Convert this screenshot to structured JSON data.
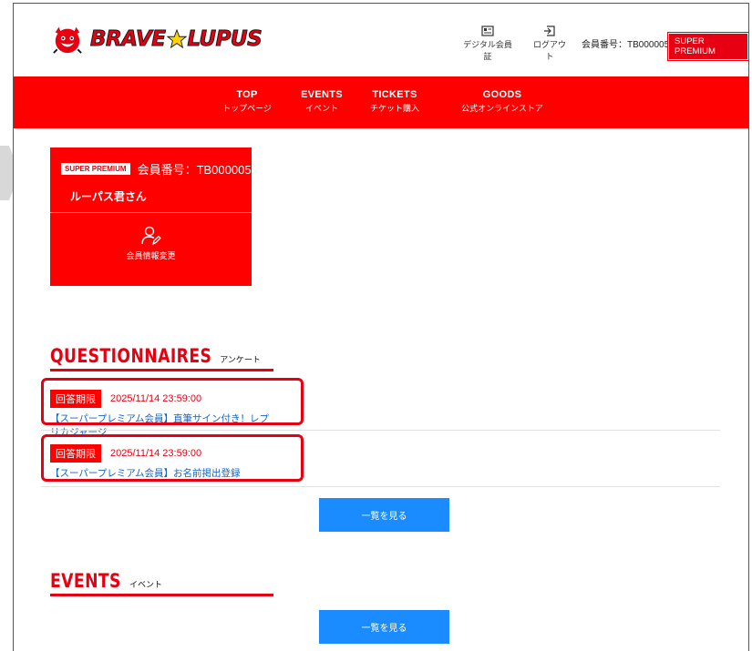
{
  "header": {
    "brand": {
      "word1": "BRAVE",
      "word2": "LUPUS"
    },
    "digital_card_label": "デジタル会員証",
    "logout_label": "ログアウト",
    "member_no": "会員番号：TB000005",
    "rank_badge": "SUPER PREMIUM"
  },
  "nav": [
    {
      "en": "TOP",
      "jp": "トップページ"
    },
    {
      "en": "EVENTS",
      "jp": "イベント"
    },
    {
      "en": "TICKETS",
      "jp": "チケット購入"
    },
    {
      "en": "GOODS",
      "jp": "公式オンラインストア"
    }
  ],
  "member_card": {
    "rank_badge": "SUPER PREMIUM",
    "member_no": "会員番号：TB000005",
    "name": "ルーパス君さん",
    "edit_label": "会員情報変更"
  },
  "questionnaires": {
    "title": "QUESTIONNAIRES",
    "subtitle": "アンケート",
    "items": [
      {
        "deadline_label": "回答期限",
        "date": "2025/11/14 23:59:00",
        "title": "【スーパープレミアム会員】直筆サイン付き！レプリカジャージ"
      },
      {
        "deadline_label": "回答期限",
        "date": "2025/11/14 23:59:00",
        "title": "【スーパープレミアム会員】お名前掲出登録"
      }
    ],
    "view_all": "一覧を見る"
  },
  "events": {
    "title": "EVENTS",
    "subtitle": "イベント",
    "view_all": "一覧を見る"
  },
  "colors": {
    "brand_red": "#ff0000",
    "accent_red": "#e60012",
    "button_blue": "#1a8cff",
    "link_blue": "#1565c0"
  }
}
